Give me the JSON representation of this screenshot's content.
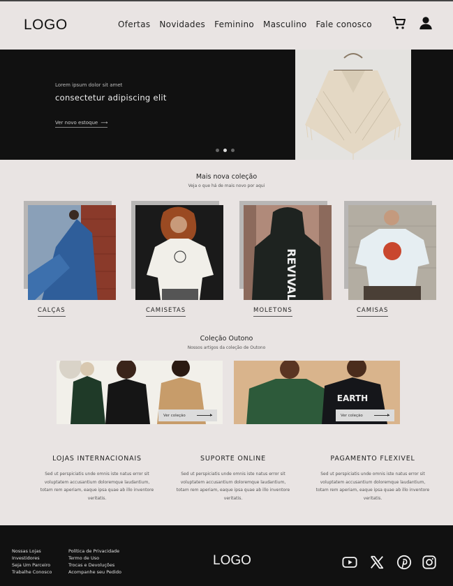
{
  "header": {
    "logo": "LOGO",
    "nav": [
      "Ofertas",
      "Novidades",
      "Feminino",
      "Masculino",
      "Fale conosco"
    ],
    "icons": [
      "cart-icon",
      "user-icon"
    ]
  },
  "hero": {
    "eyebrow": "Lorem ipsum dolor sit amet",
    "title": "consectetur adipiscing elit",
    "link_label": "Ver novo estoque",
    "link_arrow": "⟶",
    "active_slide": 2,
    "slide_count": 3
  },
  "new_collection": {
    "title": "Mais nova coleção",
    "subtitle": "Veja o que há de mais novo por aqui",
    "categories": [
      "CALÇAS",
      "CAMISETAS",
      "MOLETONS",
      "CAMISAS"
    ]
  },
  "autumn": {
    "title": "Coleção Outono",
    "subtitle": "Nossos artigos da coleção de Outono",
    "button_label": "Ver coleção"
  },
  "features": [
    {
      "title": "LOJAS INTERNACIONAIS",
      "text": "Sed ut perspiciatis unde omnis iste natus error sit voluptatem accusantium doloremque laudantium, totam rem aperiam, eaque ipsa quae ab illo inventore veritatis."
    },
    {
      "title": "SUPORTE ONLINE",
      "text": "Sed ut perspiciatis unde omnis iste natus error sit voluptatem accusantium doloremque laudantium, totam rem aperiam, eaque ipsa quae ab illo inventore veritatis."
    },
    {
      "title": "PAGAMENTO FLEXIVEL",
      "text": "Sed ut perspiciatis unde omnis iste natus error sit voluptatem accusantium doloremque laudantium, totam rem aperiam, eaque ipsa quae ab illo inventore veritatis."
    }
  ],
  "footer": {
    "col1": [
      "Nossas Lojas",
      "Investidores",
      "Seja Um Parceiro",
      "Trabalhe Conosco"
    ],
    "col2": [
      "Política de Privacidade",
      "Termo de Uso",
      "Trocas e Devoluções",
      "Acompanhe seu Pedido"
    ],
    "logo": "LOGO",
    "social": [
      "youtube-icon",
      "x-icon",
      "pinterest-icon",
      "instagram-icon"
    ]
  },
  "colors": {
    "page_bg": "#e9e4e3",
    "dark": "#111111",
    "text": "#222222"
  }
}
